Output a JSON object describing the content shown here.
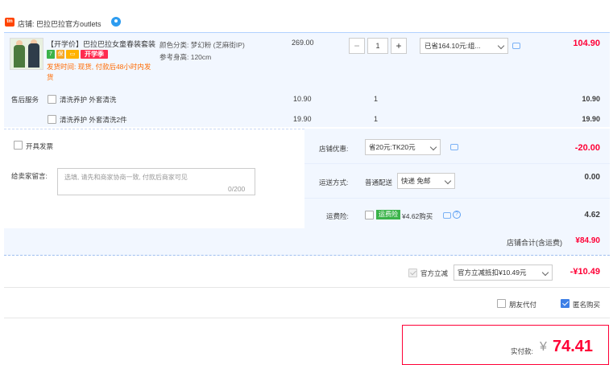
{
  "store": {
    "logo_text": "tm",
    "name": "店铺: 巴拉巴拉官方outlets"
  },
  "item": {
    "title": "【开学价】巴拉巴拉女童春装套装",
    "badge_promo": "开学季",
    "ship_note": "发货时间: 现货, 付款后48小时内发货",
    "sku_color": "颜色分类: 梦幻粉 (芝麻街IP)",
    "sku_height": "参考身高: 120cm",
    "unit_price": "269.00",
    "qty": "1",
    "qty_minus": "−",
    "qty_plus": "+",
    "discount_select": "已省164.10元:组...",
    "total": "104.90"
  },
  "services": {
    "label": "售后服务",
    "items": [
      {
        "name": "清洗养护 外套清洗",
        "price": "10.90",
        "qty": "1",
        "total": "10.90"
      },
      {
        "name": "清洗养护 外套清洗2件",
        "price": "19.90",
        "qty": "1",
        "total": "19.90"
      }
    ]
  },
  "order": {
    "invoice_label": "开具发票",
    "message_label": "给卖家留言:",
    "message_placeholder": "选填, 请先和商家协商一致, 付款后商家可见",
    "message_counter": "0/200",
    "store_discount_label": "店铺优惠:",
    "store_discount_select": "省20元:TK20元",
    "store_discount_value": "-20.00",
    "delivery_label": "运送方式:",
    "delivery_type": "普通配送",
    "delivery_select": "快递 免邮",
    "delivery_value": "0.00",
    "freight_label": "运费险:",
    "freight_tag": "运费险",
    "freight_price": "¥4.62购买",
    "freight_value": "4.62"
  },
  "subtotal": {
    "label": "店铺合计(含运费)",
    "value": "¥84.90"
  },
  "official": {
    "label": "官方立减",
    "select": "官方立减抵扣¥10.49元",
    "value": "-¥10.49"
  },
  "options": {
    "friend_pay": "朋友代付",
    "anonymous": "匿名购买"
  },
  "payment": {
    "label": "实付款:",
    "currency": "¥",
    "amount": "74.41"
  },
  "colors": {
    "accent_red": "#ff0036",
    "accent_blue": "#3d7fe6",
    "row_bg": "#f2f7ff"
  }
}
